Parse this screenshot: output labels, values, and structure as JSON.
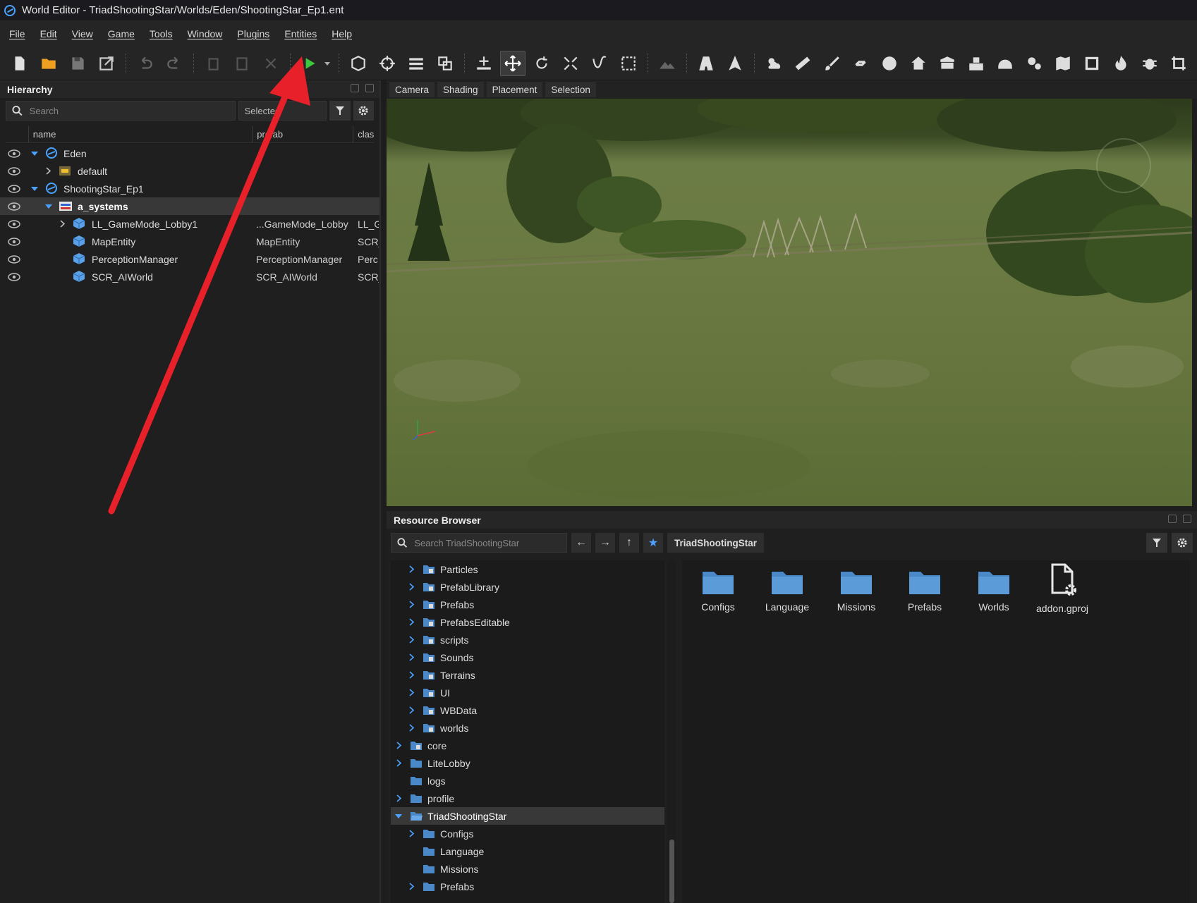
{
  "window": {
    "title": "World Editor - TriadShootingStar/Worlds/Eden/ShootingStar_Ep1.ent"
  },
  "menu": [
    "File",
    "Edit",
    "View",
    "Game",
    "Tools",
    "Window",
    "Plugins",
    "Entities",
    "Help"
  ],
  "toolbar": {
    "icons": [
      "new-file-icon",
      "open-folder-icon",
      "save-icon",
      "export-icon",
      "undo-icon",
      "redo-icon",
      "copy-icon",
      "paste-icon",
      "cut-icon",
      "play-icon",
      "play-options-icon",
      "cube-icon",
      "target-icon",
      "layers-icon",
      "snap-icon",
      "place-icon",
      "move-icon",
      "rotate-icon",
      "scale-icon",
      "curve-icon",
      "select-box-icon",
      "terrain-icon",
      "road-icon",
      "navigate-icon",
      "weather-icon",
      "ruler-icon",
      "brush-icon",
      "link-icon",
      "sphere-icon",
      "house-icon",
      "box-icon",
      "buildings-icon",
      "helmet-icon",
      "settings-icon",
      "map-icon",
      "frame-icon",
      "fire-icon",
      "bug-icon",
      "crop-icon"
    ],
    "colors": {
      "play": "#3cc83c",
      "icon": "#d8d8d8"
    }
  },
  "hierarchy": {
    "title": "Hierarchy",
    "search_placeholder": "Search",
    "selected_label": "Selected",
    "columns": [
      "name",
      "prefab",
      "class"
    ],
    "rows": [
      {
        "name": "Eden",
        "prefab": "",
        "class": "",
        "icon": "world-icon"
      },
      {
        "name": "default",
        "prefab": "",
        "class": "",
        "icon": "layer-icon"
      },
      {
        "name": "ShootingStar_Ep1",
        "prefab": "",
        "class": "",
        "icon": "world-icon"
      },
      {
        "name": "a_systems",
        "prefab": "",
        "class": "",
        "icon": "layer-icon"
      },
      {
        "name": "LL_GameMode_Lobby1",
        "prefab": "...GameMode_Lobby",
        "class": "LL_G",
        "icon": "entity-icon"
      },
      {
        "name": "MapEntity",
        "prefab": "MapEntity",
        "class": "SCR_",
        "icon": "entity-icon"
      },
      {
        "name": "PerceptionManager",
        "prefab": "PerceptionManager",
        "class": "Perc",
        "icon": "entity-icon"
      },
      {
        "name": "SCR_AIWorld",
        "prefab": "SCR_AIWorld",
        "class": "SCR_",
        "icon": "entity-icon"
      }
    ]
  },
  "viewport": {
    "tabs": [
      "Camera",
      "Shading",
      "Placement",
      "Selection"
    ]
  },
  "resource_browser": {
    "title": "Resource Browser",
    "search_placeholder": "Search TriadShootingStar",
    "breadcrumb": "TriadShootingStar",
    "tree": [
      {
        "label": "Particles",
        "icon": "locked-folder-icon"
      },
      {
        "label": "PrefabLibrary",
        "icon": "locked-folder-icon"
      },
      {
        "label": "Prefabs",
        "icon": "locked-folder-icon"
      },
      {
        "label": "PrefabsEditable",
        "icon": "locked-folder-icon"
      },
      {
        "label": "scripts",
        "icon": "locked-folder-icon"
      },
      {
        "label": "Sounds",
        "icon": "locked-folder-icon"
      },
      {
        "label": "Terrains",
        "icon": "locked-folder-icon"
      },
      {
        "label": "UI",
        "icon": "locked-folder-icon"
      },
      {
        "label": "WBData",
        "icon": "locked-folder-icon"
      },
      {
        "label": "worlds",
        "icon": "locked-folder-icon"
      },
      {
        "label": "core",
        "icon": "locked-folder-icon"
      },
      {
        "label": "LiteLobby",
        "icon": "folder-icon"
      },
      {
        "label": "logs",
        "icon": "folder-icon"
      },
      {
        "label": "profile",
        "icon": "folder-icon"
      },
      {
        "label": "TriadShootingStar",
        "icon": "open-folder-icon"
      },
      {
        "label": "Configs",
        "icon": "folder-icon"
      },
      {
        "label": "Language",
        "icon": "folder-icon"
      },
      {
        "label": "Missions",
        "icon": "folder-icon"
      },
      {
        "label": "Prefabs",
        "icon": "folder-icon"
      }
    ],
    "grid": [
      {
        "label": "Configs",
        "icon": "folder-icon"
      },
      {
        "label": "Language",
        "icon": "folder-icon"
      },
      {
        "label": "Missions",
        "icon": "folder-icon"
      },
      {
        "label": "Prefabs",
        "icon": "folder-icon"
      },
      {
        "label": "Worlds",
        "icon": "folder-icon"
      },
      {
        "label": "addon.gproj",
        "icon": "project-file-icon"
      }
    ]
  },
  "annotation": {
    "arrow_color": "#e8202a"
  }
}
